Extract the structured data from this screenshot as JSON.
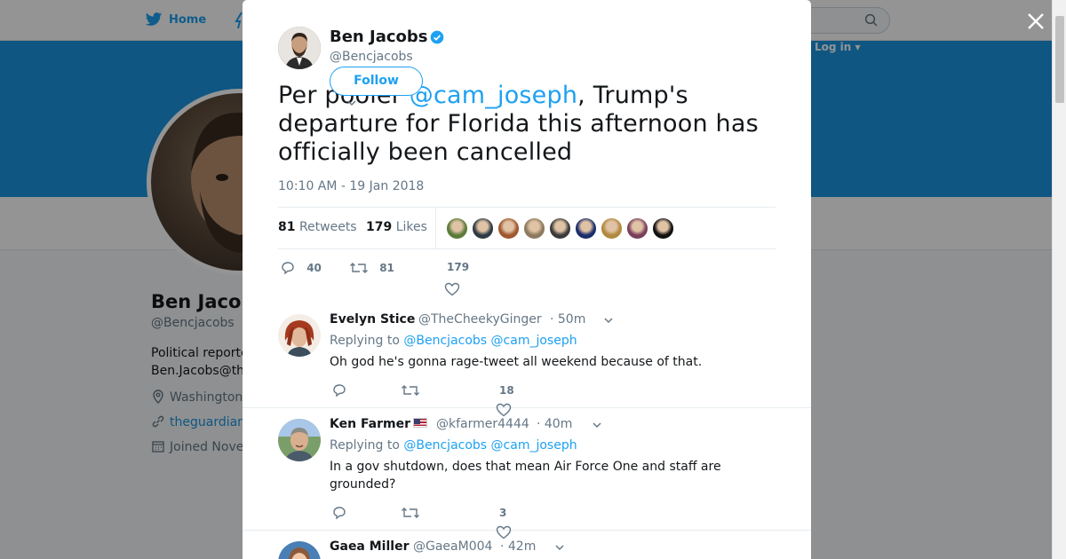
{
  "background": {
    "nav": {
      "home_label": "Home",
      "login_label": "Log in ▾"
    },
    "profile": {
      "name": "Ben Jacobs",
      "handle": "@Bencjacobs",
      "bio_line1": "Political reporter",
      "bio_line2": "Ben.Jacobs@theguardian.com",
      "location": "Washington",
      "website": "theguardian.com",
      "joined": "Joined November"
    }
  },
  "tweet": {
    "author_name": "Ben Jacobs",
    "author_handle": "@Bencjacobs",
    "follow_label": "Follow",
    "text_before": "Per pooler ",
    "mention": "@cam_joseph",
    "text_after": ", Trump's departure for Florida this afternoon has officially been cancelled",
    "timestamp": "10:10 AM - 19 Jan 2018",
    "retweets_count": "81",
    "retweets_label": "Retweets",
    "likes_count": "179",
    "likes_label": "Likes",
    "likers": [
      "#5b7c3a",
      "#2f3a44",
      "#a0572e",
      "#8c7a5e",
      "#3b3b3b",
      "#1c2d6b",
      "#b0893f",
      "#7a3f5e",
      "#111111"
    ],
    "actions": {
      "replies": "40",
      "retweets": "81",
      "likes": "179"
    }
  },
  "replies": [
    {
      "name": "Evelyn Stice",
      "handle": "@TheCheekyGinger",
      "time": "· 50m",
      "replying_label": "Replying to",
      "replying_to": "@Bencjacobs @cam_joseph",
      "text": "Oh god he's gonna rage-tweet all weekend because of that.",
      "likes": "18",
      "flag": false
    },
    {
      "name": "Ken Farmer",
      "handle": "@kfarmer4444",
      "time": "· 40m",
      "replying_label": "Replying to",
      "replying_to": "@Bencjacobs @cam_joseph",
      "text": "In a gov shutdown, does that mean Air Force One and staff are grounded?",
      "likes": "3",
      "flag": true
    },
    {
      "name": "Gaea Miller",
      "handle": "@GaeaM004",
      "time": "· 42m",
      "flag": false
    }
  ],
  "colors": {
    "accent": "#1da1f2",
    "banner": "#1b95e0",
    "muted": "#657786"
  }
}
